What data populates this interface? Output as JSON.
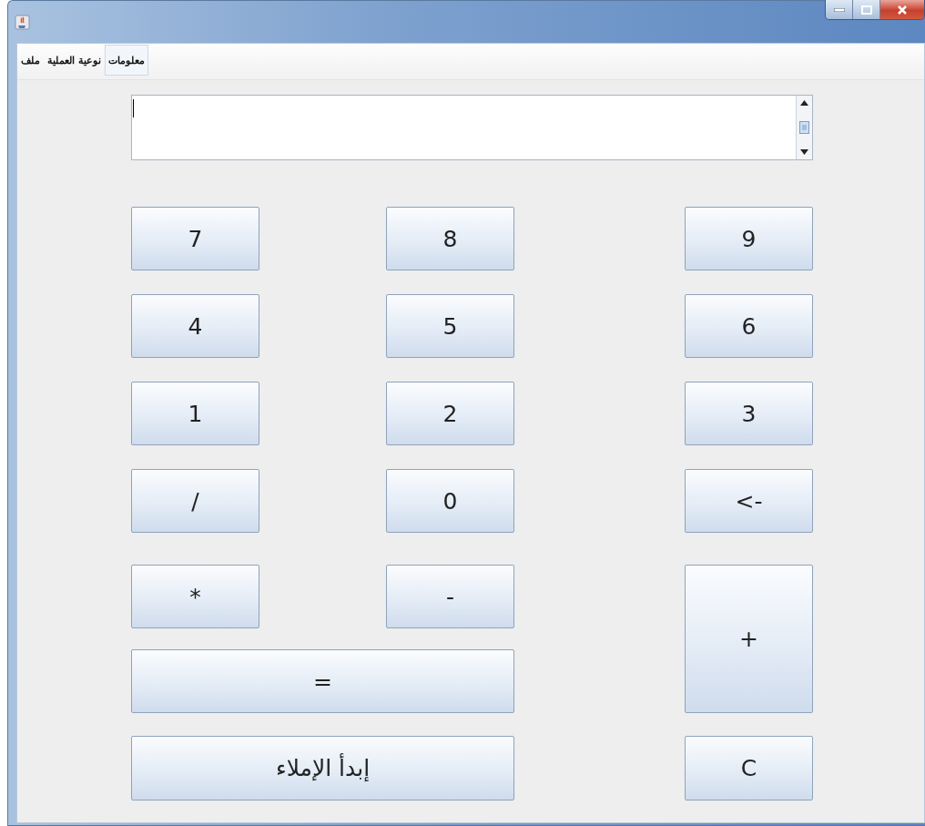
{
  "menu": [
    {
      "label": "معلومات",
      "selected": true
    },
    {
      "label": "نوعية العملية",
      "selected": false
    },
    {
      "label": "ملف",
      "selected": false
    }
  ],
  "keys": [
    "9",
    "8",
    "7",
    "6",
    "5",
    "4",
    "3",
    "2",
    "1",
    "<-",
    "0",
    "/",
    "+",
    "-",
    "*",
    "=",
    "C",
    "إبدأ الإملاء"
  ]
}
